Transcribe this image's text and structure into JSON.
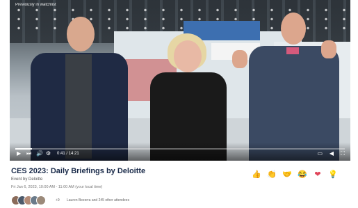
{
  "video": {
    "overlay_caption": "Previously in watchlist",
    "time": "0:41 / 14:21"
  },
  "event": {
    "title": "CES 2023: Daily Briefings by Deloitte",
    "subtitle": "Event by Deloitte",
    "meta": "Fri Jan 6, 2023, 10:00 AM - 11:00 AM (your local time)"
  },
  "attendees": {
    "count_label": "+9",
    "text": "Lauren Bezerra and 245 other attendees"
  },
  "reactions": [
    {
      "icon": "like-icon",
      "glyph": "👍"
    },
    {
      "icon": "celebrate-icon",
      "glyph": "👏"
    },
    {
      "icon": "support-icon",
      "glyph": "🤝"
    },
    {
      "icon": "funny-icon",
      "glyph": "😂"
    },
    {
      "icon": "love-icon",
      "glyph": "❤"
    },
    {
      "icon": "insightful-icon",
      "glyph": "💡"
    }
  ],
  "colors": {
    "title": "#1a2b4a",
    "progress": "#ffffff"
  },
  "playback_progress_fraction": 0.05
}
